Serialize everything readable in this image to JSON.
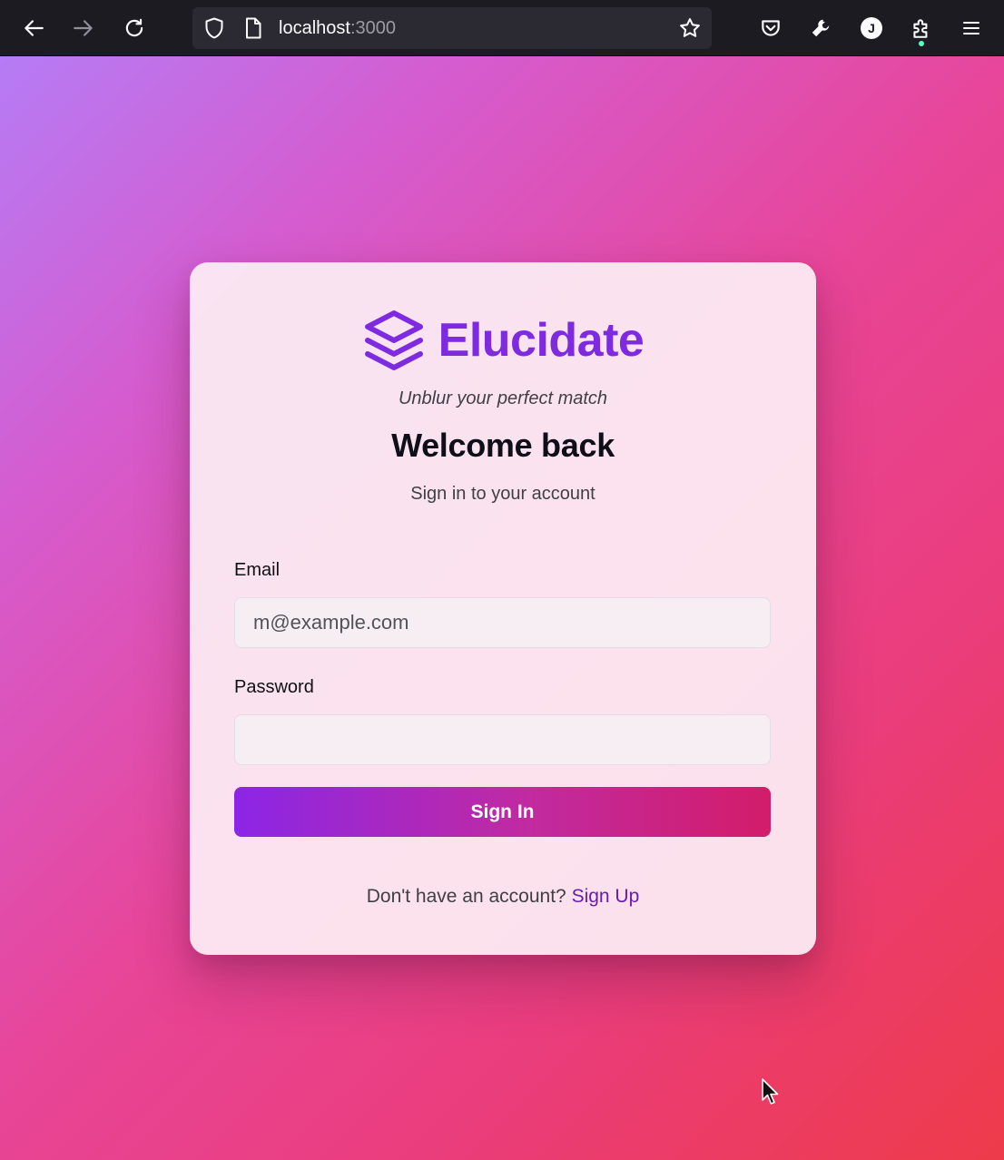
{
  "browser": {
    "url_host": "localhost",
    "url_port": ":3000",
    "account_initial": "J",
    "icons": {
      "back": "arrow-left-icon",
      "forward": "arrow-right-icon",
      "reload": "reload-icon",
      "tracking": "shield-icon",
      "page": "page-icon",
      "bookmark": "star-icon",
      "pocket": "pocket-icon",
      "devtools": "wrench-icon",
      "extensions": "puzzle-icon",
      "menu": "hamburger-menu-icon"
    }
  },
  "auth": {
    "brand_name": "Elucidate",
    "brand_icon": "layers-icon",
    "tagline": "Unblur your perfect match",
    "heading": "Welcome back",
    "subheading": "Sign in to your account",
    "email_label": "Email",
    "email_placeholder": "m@example.com",
    "email_value": "",
    "password_label": "Password",
    "password_value": "",
    "submit_label": "Sign In",
    "footer_prompt": "Don't have an account? ",
    "signup_link": "Sign Up"
  },
  "colors": {
    "brand": "#7e2ae0",
    "link": "#6a1bb0",
    "button_gradient_start": "#8b26e6",
    "button_gradient_end": "#d31c6a",
    "background_gradient_start": "#b57cf5",
    "background_gradient_end": "#ee3b4a"
  }
}
